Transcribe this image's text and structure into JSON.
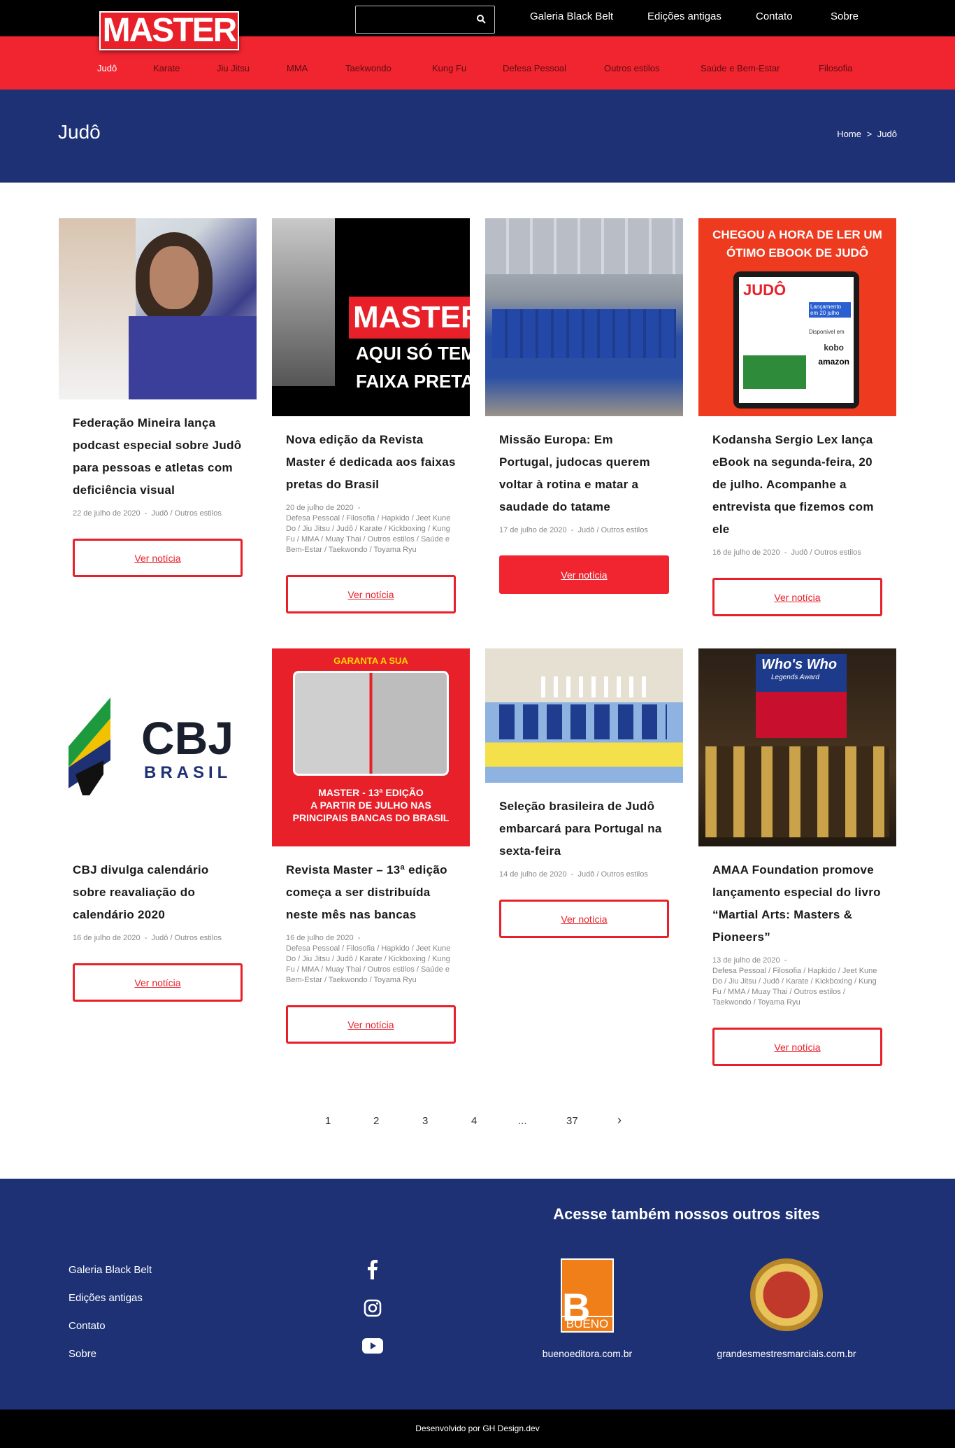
{
  "header": {
    "logo_text": "MASTER",
    "top_nav": [
      "Galeria Black Belt",
      "Edições antigas",
      "Contato",
      "Sobre"
    ],
    "category_nav": [
      "Judô",
      "Karate",
      "Jiu Jitsu",
      "MMA",
      "Taekwondo",
      "Kung Fu",
      "Defesa Pessoal",
      "Outros estilos",
      "Saúde e Bem-Estar",
      "Filosofia"
    ]
  },
  "page": {
    "title": "Judô",
    "breadcrumb_home": "Home",
    "breadcrumb_sep": ">",
    "breadcrumb_current": "Judô"
  },
  "articles": [
    {
      "title": "Federação Mineira lança podcast especial sobre Judô para pessoas e atletas com deficiência visual",
      "date": "22 de julho de 2020",
      "cats": "Judô / Outros estilos",
      "button": "Ver notícia"
    },
    {
      "title": "Nova edição da Revista Master é dedicada aos faixas pretas do Brasil",
      "date": "20 de julho de 2020",
      "cats": "Defesa Pessoal / Filosofia / Hapkido / Jeet Kune Do / Jiu Jitsu / Judô / Karate / Kickboxing / Kung Fu / MMA / Muay Thai / Outros estilos / Saúde e Bem-Estar / Taekwondo / Toyama Ryu",
      "button": "Ver notícia",
      "image_text": [
        "MASTER",
        "AQUI SÓ TEM",
        "FAIXA PRETA"
      ]
    },
    {
      "title": "Missão Europa: Em Portugal, judocas querem voltar à rotina e matar a saudade do tatame",
      "date": "17 de julho de 2020",
      "cats": "Judô / Outros estilos",
      "button": "Ver notícia"
    },
    {
      "title": "Kodansha Sergio Lex lança eBook na segunda-feira, 20 de julho. Acompanhe a entrevista que fizemos com ele",
      "date": "16 de julho de 2020",
      "cats": "Judô / Outros estilos",
      "button": "Ver notícia",
      "image_text": [
        "CHEGOU A HORA DE LER UM",
        "ÓTIMO EBOOK DE JUDÔ",
        "JUDÔ",
        "Lançamento em 20 julho",
        "Disponível em",
        "kobo",
        "amazon"
      ]
    },
    {
      "title": "CBJ divulga calendário sobre reavaliação do calendário 2020",
      "date": "16 de julho de 2020",
      "cats": "Judô / Outros estilos",
      "button": "Ver notícia",
      "image_text": [
        "CBJ",
        "BRASIL"
      ]
    },
    {
      "title": "Revista Master – 13ª edição começa a ser distribuída neste mês nas bancas",
      "date": "16 de julho de 2020",
      "cats": "Defesa Pessoal / Filosofia / Hapkido / Jeet Kune Do / Jiu Jitsu / Judô / Karate / Kickboxing / Kung Fu / MMA / Muay Thai / Outros estilos / Saúde e Bem-Estar / Taekwondo / Toyama Ryu",
      "button": "Ver notícia",
      "image_text": [
        "GARANTA A SUA",
        "MASTER - 13ª EDIÇÃO",
        "A PARTIR DE JULHO NAS",
        "PRINCIPAIS BANCAS DO BRASIL"
      ]
    },
    {
      "title": "Seleção brasileira de Judô embarcará para Portugal na sexta-feira",
      "date": "14 de julho de 2020",
      "cats": "Judô / Outros estilos",
      "button": "Ver notícia"
    },
    {
      "title": "AMAA Foundation promove lançamento especial do livro “Martial Arts: Masters & Pioneers”",
      "date": "13 de julho de 2020",
      "cats": "Defesa Pessoal / Filosofia / Hapkido / Jeet Kune Do / Jiu Jitsu / Judô / Karate / Kickboxing / Kung Fu / MMA / Muay Thai / Outros estilos / Taekwondo / Toyama Ryu",
      "button": "Ver notícia",
      "image_text": [
        "Who's Who",
        "Legends Award"
      ]
    }
  ],
  "pagination": [
    "1",
    "2",
    "3",
    "4",
    "...",
    "37",
    "›"
  ],
  "footer": {
    "links": [
      "Galeria Black Belt",
      "Edições antigas",
      "Contato",
      "Sobre"
    ],
    "other_sites_title": "Acesse também nossos outros sites",
    "site1": "buenoeditora.com.br",
    "site1_logo": "BUENO",
    "site2": "grandesmestresmarciais.com.br",
    "credit": "Desenvolvido por GH Design.dev"
  },
  "colors": {
    "red": "#f12530",
    "navy": "#1e3175",
    "black": "#000000"
  }
}
